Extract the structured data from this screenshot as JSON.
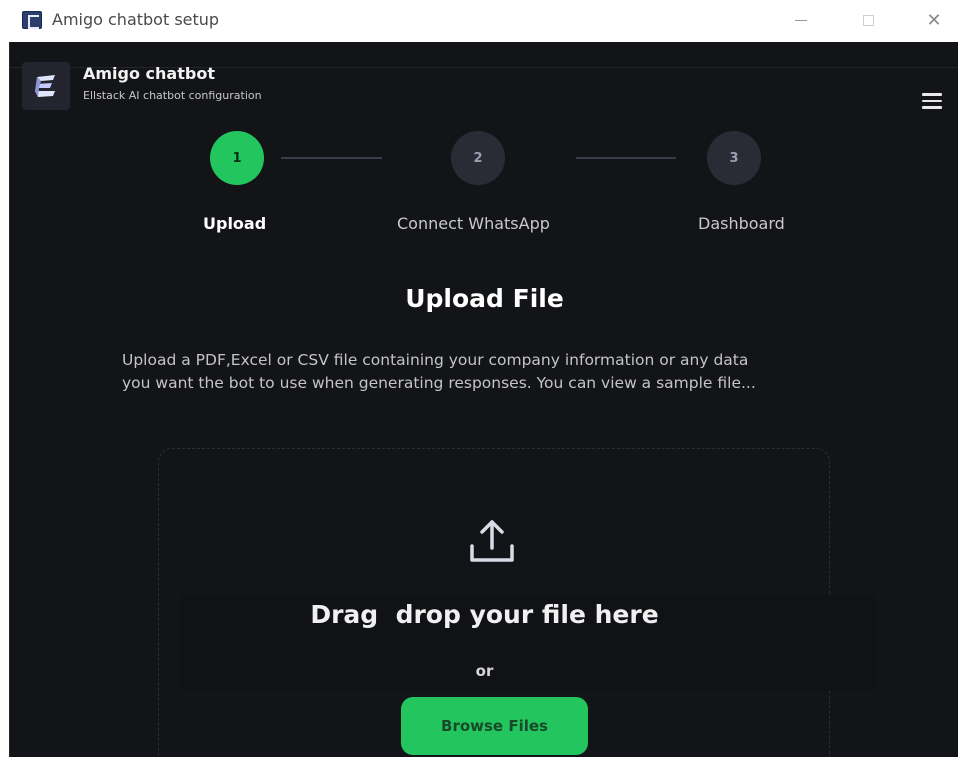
{
  "window": {
    "title": "Amigo chatbot setup",
    "icon": "app-logo-icon",
    "controls": [
      "minimize",
      "maximize",
      "close"
    ],
    "close_glyph": "✕"
  },
  "header": {
    "app_name": "Amigo chatbot",
    "subtitle": "Ellstack AI chatbot configuration",
    "logo_icon": "ellstack-logo-icon",
    "menu_icon": "hamburger-menu-icon"
  },
  "stepper": {
    "steps": [
      {
        "number": "1",
        "label": "Upload",
        "state": "active"
      },
      {
        "number": "2",
        "label": "Connect WhatsApp",
        "state": "pending"
      },
      {
        "number": "3",
        "label": "Dashboard",
        "state": "pending"
      }
    ]
  },
  "main": {
    "title": "Upload File",
    "description_line1": "Upload a PDF,Excel or CSV file containing your company information or any data",
    "description_line2": "you want the bot to use when generating responses. You can view a sample file...",
    "dropzone": {
      "icon": "upload-icon",
      "drop_text": "Drag  drop your file here",
      "or_text": "or",
      "browse_label": "Browse Files"
    }
  },
  "colors": {
    "accent": "#22c55e",
    "background": "#131417",
    "step_inactive": "#2a2c35"
  }
}
